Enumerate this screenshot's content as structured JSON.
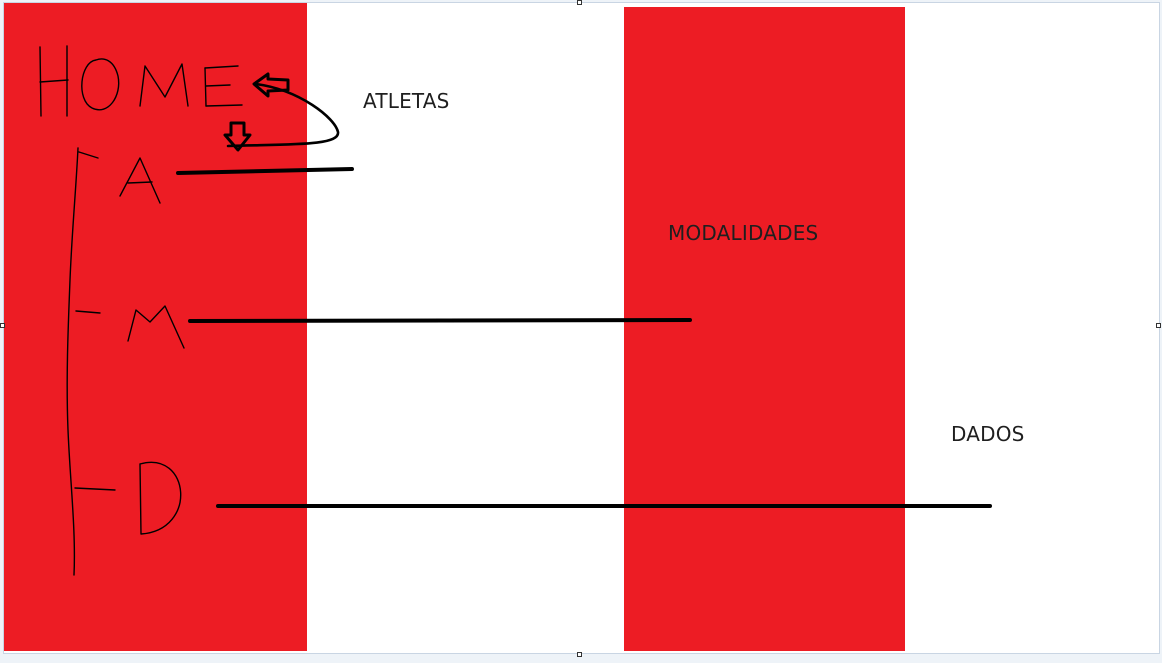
{
  "sketch": {
    "home_text": "HOME",
    "menu_letters": [
      "A",
      "M",
      "D"
    ]
  },
  "labels": {
    "atletas": "ATLETAS",
    "modalidades": "MODALIDADES",
    "dados": "DADOS"
  },
  "colors": {
    "band": "#ed1c24",
    "ink": "#000000",
    "background": "#ffffff"
  }
}
